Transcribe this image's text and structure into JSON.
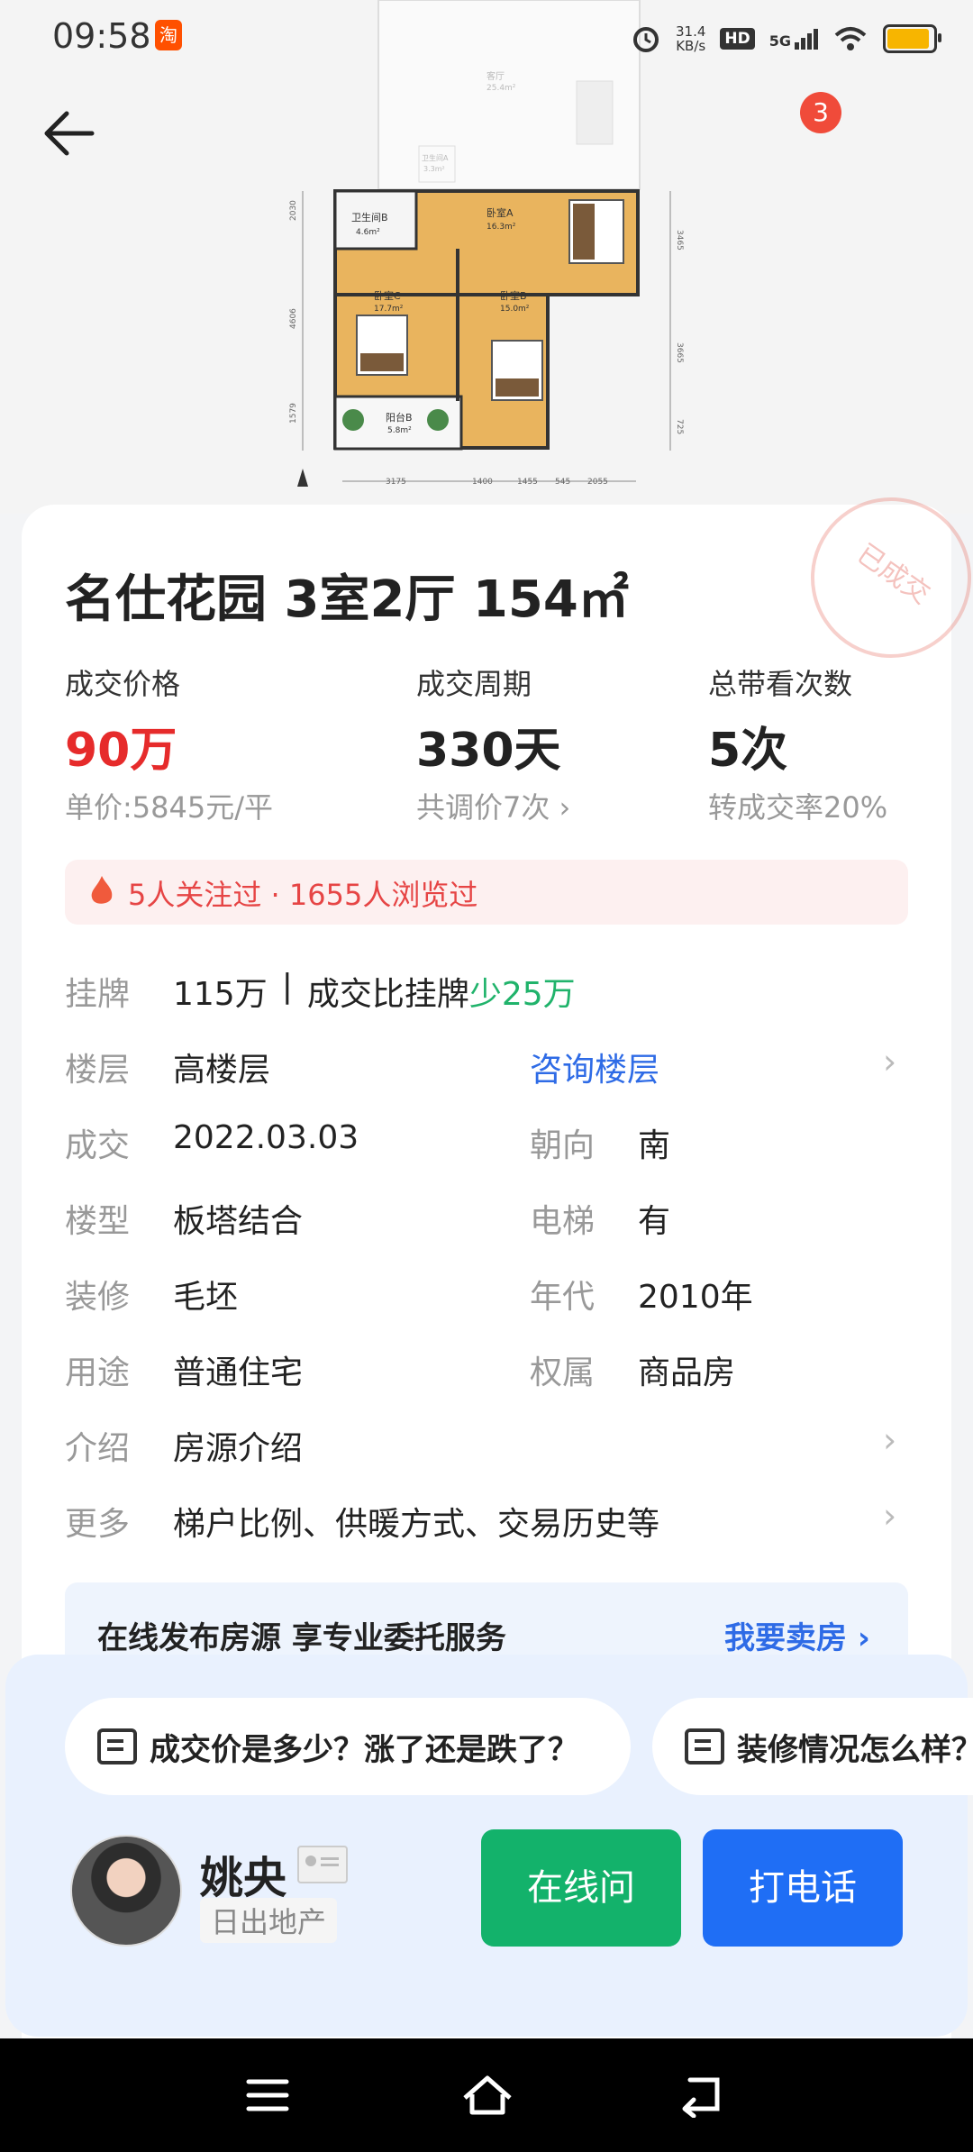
{
  "status_bar": {
    "time": "09:58",
    "speed_value": "31.4",
    "speed_unit": "KB/s",
    "hd": "HD",
    "network": "5G",
    "app_icon": "taobao-app-icon",
    "battery_level": 0.85,
    "battery_color": "#f7b500"
  },
  "header": {
    "notification_count": "3"
  },
  "floor_plan": {
    "rooms": [
      {
        "name": "卧室A",
        "area": "16.3m²"
      },
      {
        "name": "卫生间B",
        "area": "4.6m²"
      },
      {
        "name": "卧室C",
        "area": "17.7m²"
      },
      {
        "name": "卧室B",
        "area": "15.0m²"
      },
      {
        "name": "阳台B",
        "area": "5.8m²"
      },
      {
        "name": "客厅",
        "area": "25.4m²"
      },
      {
        "name": "卫生间A",
        "area": "3.3m²"
      }
    ],
    "dims_bottom": [
      "3175",
      "1400",
      "1455",
      "545",
      "2055"
    ],
    "dims_left": [
      "2030",
      "4606",
      "1579"
    ],
    "dims_right": [
      "3465",
      "3665",
      "725"
    ]
  },
  "listing": {
    "title": "名仕花园 3室2厅 154㎡",
    "stamp": "已成交",
    "stats": [
      {
        "label": "成交价格",
        "value": "90万",
        "sub": "单价:5845元/平"
      },
      {
        "label": "成交周期",
        "value": "330天",
        "sub": "共调价7次 ›"
      },
      {
        "label": "总带看次数",
        "value": "5次",
        "sub": "转成交率20%"
      }
    ],
    "hot_info": "5人关注过 · 1655人浏览过",
    "listed": {
      "label": "挂牌",
      "price": "115万",
      "separator": "|",
      "compare": "成交比挂牌",
      "diff": "少25万"
    },
    "details": {
      "floor": {
        "label": "楼层",
        "value": "高楼层",
        "link": "咨询楼层"
      },
      "deal": {
        "label": "成交",
        "value": "2022.03.03"
      },
      "orientation": {
        "label": "朝向",
        "value": "南"
      },
      "building_type": {
        "label": "楼型",
        "value": "板塔结合"
      },
      "elevator": {
        "label": "电梯",
        "value": "有"
      },
      "decoration": {
        "label": "装修",
        "value": "毛坯"
      },
      "year": {
        "label": "年代",
        "value": "2010年"
      },
      "usage": {
        "label": "用途",
        "value": "普通住宅"
      },
      "ownership": {
        "label": "权属",
        "value": "商品房"
      },
      "intro": {
        "label": "介绍",
        "value": "房源介绍"
      },
      "more": {
        "label": "更多",
        "value": "梯户比例、供暖方式、交易历史等"
      }
    },
    "promo": {
      "text": "在线发布房源 享专业委托服务",
      "link": "我要卖房 ›"
    }
  },
  "questions": [
    "成交价是多少？涨了还是跌了？",
    "装修情况怎么样？"
  ],
  "agent": {
    "name": "姚央",
    "company": "日出地产"
  },
  "buttons": {
    "online": "在线问",
    "call": "打电话"
  },
  "colors": {
    "price_red": "#e62b2b",
    "green": "#20b36b",
    "link_blue": "#2e6be6",
    "online_green": "#13b26b",
    "call_blue": "#1f6ef5"
  }
}
